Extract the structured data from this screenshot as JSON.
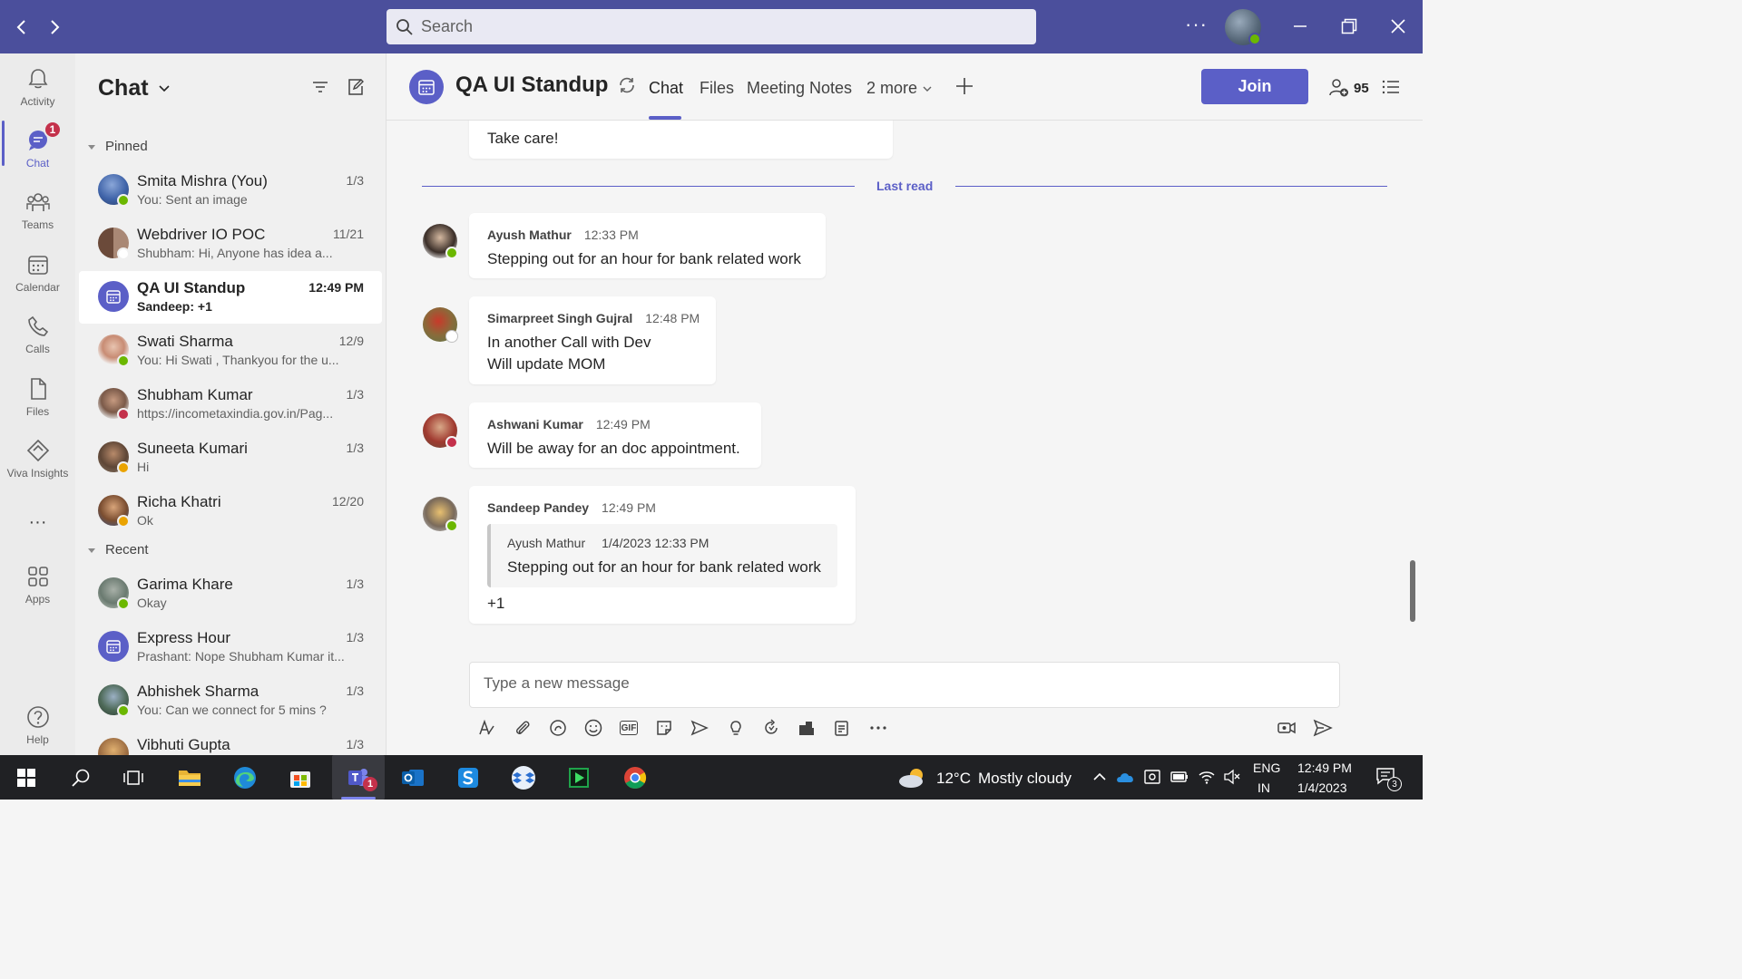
{
  "titlebar": {
    "search_placeholder": "Search",
    "more_label": "···"
  },
  "rail": {
    "items": [
      {
        "label": "Activity"
      },
      {
        "label": "Chat",
        "badge": "1"
      },
      {
        "label": "Teams"
      },
      {
        "label": "Calendar"
      },
      {
        "label": "Calls"
      },
      {
        "label": "Files"
      },
      {
        "label": "Viva Insights"
      },
      {
        "label": "···"
      },
      {
        "label": "Apps"
      },
      {
        "label": "Help"
      }
    ]
  },
  "chatpanel": {
    "title": "Chat",
    "pinned_label": "Pinned",
    "recent_label": "Recent",
    "pinned": [
      {
        "name": "Smita Mishra (You)",
        "preview": "You: Sent an image",
        "date": "1/3"
      },
      {
        "name": "Webdriver IO POC",
        "preview": "Shubham: Hi, Anyone has idea a...",
        "date": "11/21"
      },
      {
        "name": "QA UI Standup",
        "preview": "Sandeep: +1",
        "date": "12:49 PM"
      },
      {
        "name": "Swati Sharma",
        "preview": "You: Hi Swati , Thankyou for the u...",
        "date": "12/9"
      },
      {
        "name": "Shubham Kumar",
        "preview": "https://incometaxindia.gov.in/Pag...",
        "date": "1/3"
      },
      {
        "name": "Suneeta Kumari",
        "preview": "Hi",
        "date": "1/3"
      },
      {
        "name": "Richa Khatri",
        "preview": "Ok",
        "date": "12/20"
      }
    ],
    "recent": [
      {
        "name": "Garima Khare",
        "preview": "Okay",
        "date": "1/3"
      },
      {
        "name": "Express Hour",
        "preview": "Prashant: Nope Shubham Kumar it...",
        "date": "1/3"
      },
      {
        "name": "Abhishek Sharma",
        "preview": "You: Can we connect for 5 mins ?",
        "date": "1/3"
      },
      {
        "name": "Vibhuti Gupta",
        "preview": "",
        "date": "1/3"
      }
    ]
  },
  "header": {
    "title": "QA UI Standup",
    "tabs": [
      {
        "label": "Chat"
      },
      {
        "label": "Files"
      },
      {
        "label": "Meeting Notes"
      },
      {
        "label": "2 more"
      }
    ],
    "join_label": "Join",
    "participants": "95"
  },
  "messages": {
    "prev_text": "Take care!",
    "last_read": "Last read",
    "items": [
      {
        "author": "Ayush Mathur",
        "time": "12:33 PM",
        "lines": [
          "Stepping out for an hour for bank related work"
        ]
      },
      {
        "author": "Simarpreet Singh Gujral",
        "time": "12:48 PM",
        "lines": [
          "In another Call with Dev",
          "Will update MOM"
        ]
      },
      {
        "author": "Ashwani Kumar",
        "time": "12:49 PM",
        "lines": [
          "Will be away for an doc appointment."
        ]
      },
      {
        "author": "Sandeep Pandey",
        "time": "12:49 PM",
        "quote_author": "Ayush Mathur",
        "quote_time": "1/4/2023 12:33 PM",
        "quote_text": "Stepping out for an hour for bank related work",
        "lines": [
          "+1"
        ]
      }
    ]
  },
  "compose": {
    "placeholder": "Type a new message",
    "gif_label": "GIF"
  },
  "taskbar": {
    "teams_badge": "1",
    "weather_temp": "12°C",
    "weather_desc": "Mostly cloudy",
    "lang": "ENG",
    "region": "IN",
    "time": "12:49 PM",
    "date": "1/4/2023",
    "notif_count": "3"
  },
  "colors": {
    "brand": "#5b5fc7",
    "titlebar": "#4b4f9c",
    "available": "#6bb700",
    "busy": "#c4314b",
    "away": "#eaa300"
  }
}
